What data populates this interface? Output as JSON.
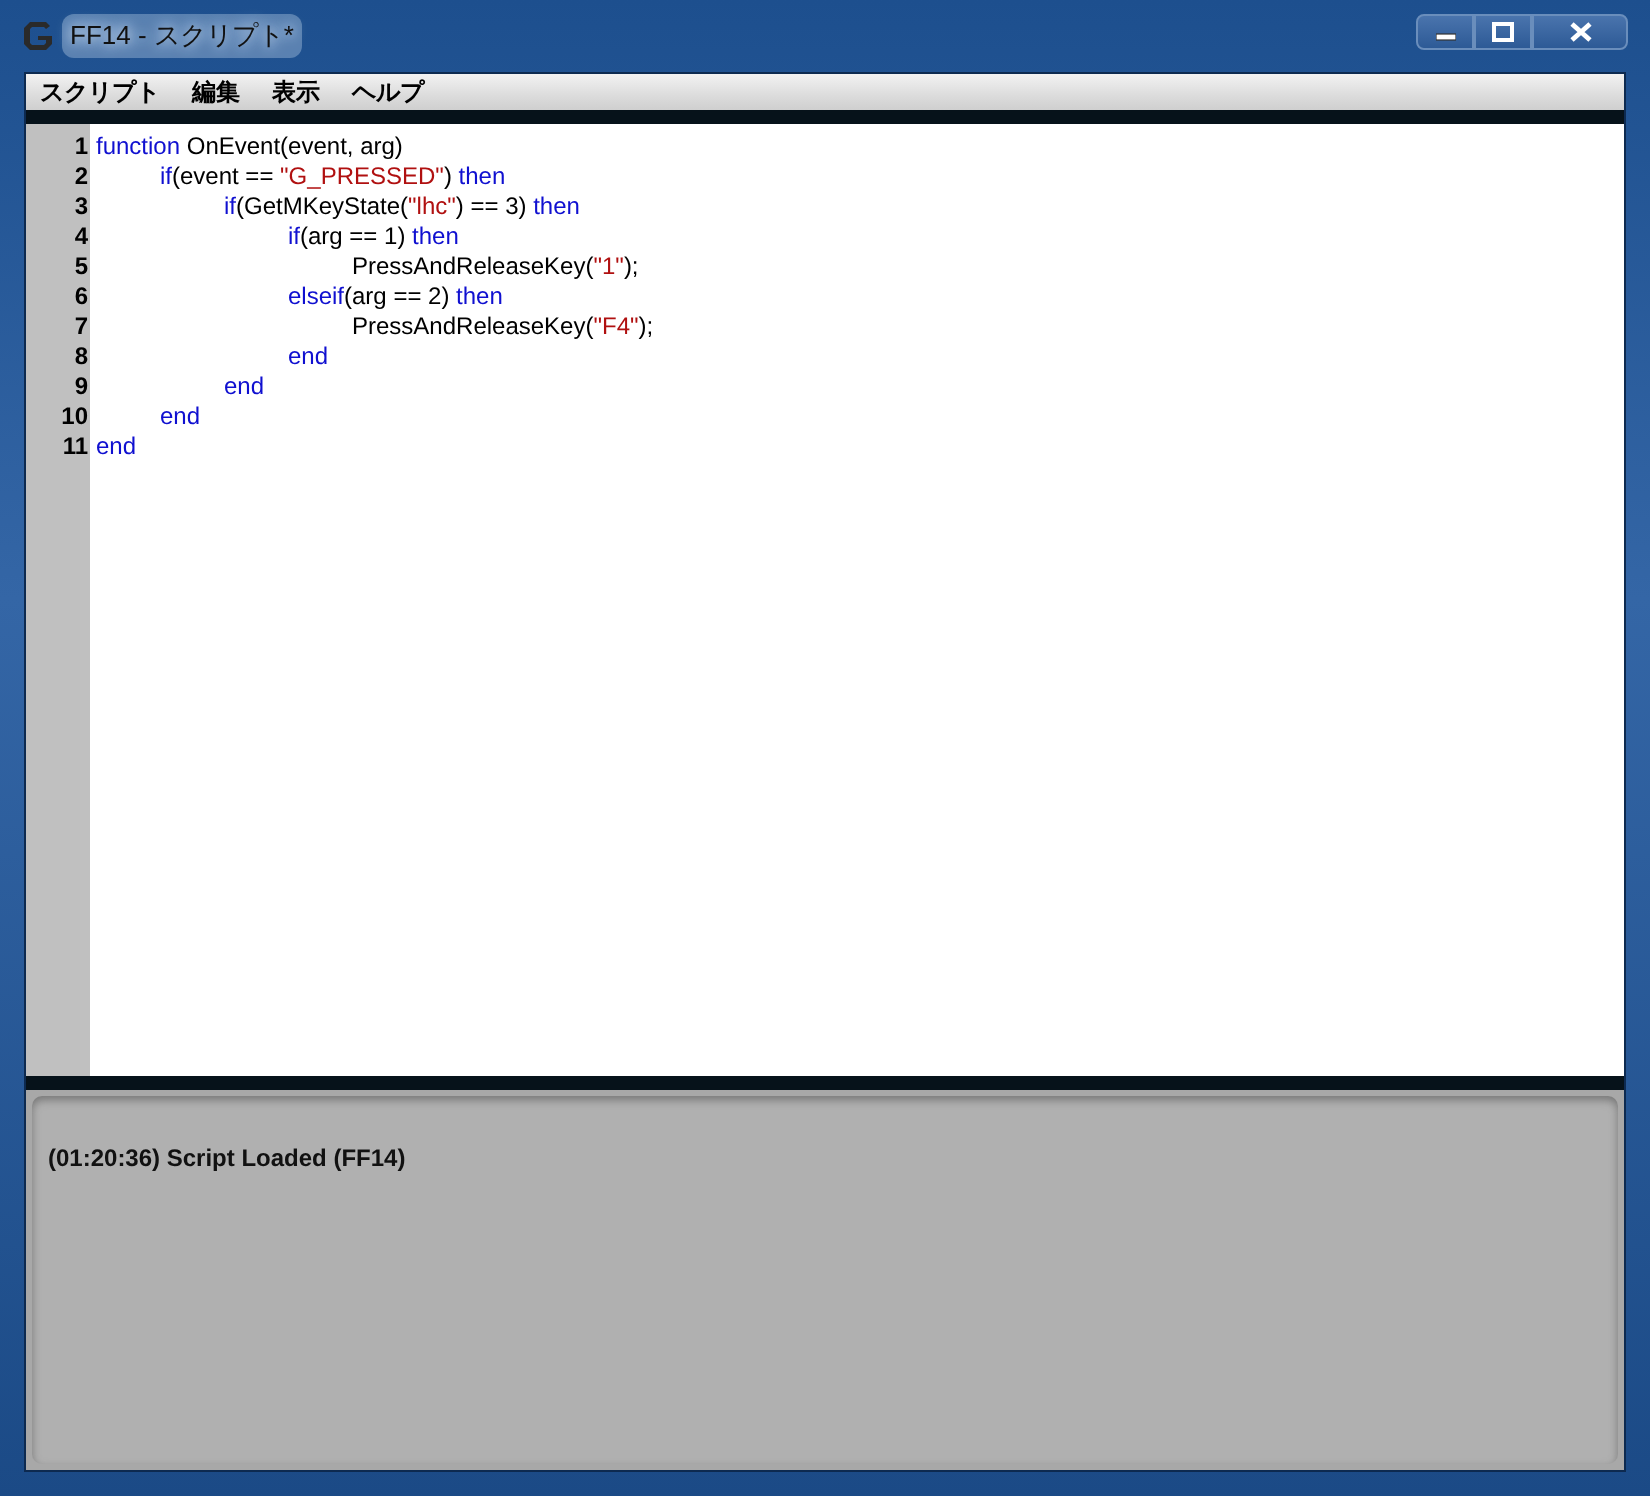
{
  "window": {
    "title": "FF14 - スクリプト*"
  },
  "menu": [
    "スクリプト",
    "編集",
    "表示",
    "ヘルプ"
  ],
  "editor": {
    "lines": [
      {
        "number": "1",
        "tokens": [
          {
            "kind": "keyword",
            "text": "function"
          },
          {
            "kind": "plain",
            "text": " OnEvent(event, arg)"
          }
        ]
      },
      {
        "number": "2",
        "tokens": [
          {
            "kind": "keyword",
            "text": "\tif"
          },
          {
            "kind": "plain",
            "text": "(event == "
          },
          {
            "kind": "string",
            "text": "\"G_PRESSED\""
          },
          {
            "kind": "plain",
            "text": ") "
          },
          {
            "kind": "keyword",
            "text": "then"
          }
        ]
      },
      {
        "number": "3",
        "tokens": [
          {
            "kind": "keyword",
            "text": "\t\tif"
          },
          {
            "kind": "plain",
            "text": "(GetMKeyState("
          },
          {
            "kind": "string",
            "text": "\"lhc\""
          },
          {
            "kind": "plain",
            "text": ") == 3) "
          },
          {
            "kind": "keyword",
            "text": "then"
          }
        ]
      },
      {
        "number": "4",
        "tokens": [
          {
            "kind": "keyword",
            "text": "\t\t\tif"
          },
          {
            "kind": "plain",
            "text": "(arg == 1) "
          },
          {
            "kind": "keyword",
            "text": "then"
          }
        ]
      },
      {
        "number": "5",
        "tokens": [
          {
            "kind": "plain",
            "text": "\t\t\t\tPressAndReleaseKey("
          },
          {
            "kind": "string",
            "text": "\"1\""
          },
          {
            "kind": "plain",
            "text": ");"
          }
        ]
      },
      {
        "number": "6",
        "tokens": [
          {
            "kind": "keyword",
            "text": "\t\t\telseif"
          },
          {
            "kind": "plain",
            "text": "(arg == 2) "
          },
          {
            "kind": "keyword",
            "text": "then"
          }
        ]
      },
      {
        "number": "7",
        "tokens": [
          {
            "kind": "plain",
            "text": "\t\t\t\tPressAndReleaseKey("
          },
          {
            "kind": "string",
            "text": "\"F4\""
          },
          {
            "kind": "plain",
            "text": ");"
          }
        ]
      },
      {
        "number": "8",
        "tokens": [
          {
            "kind": "keyword",
            "text": "\t\t\tend"
          }
        ]
      },
      {
        "number": "9",
        "tokens": [
          {
            "kind": "keyword",
            "text": "\t\tend"
          }
        ]
      },
      {
        "number": "10",
        "tokens": [
          {
            "kind": "keyword",
            "text": "\tend"
          }
        ]
      },
      {
        "number": "11",
        "tokens": [
          {
            "kind": "keyword",
            "text": "end"
          }
        ]
      }
    ]
  },
  "output": {
    "messages": [
      "(01:20:36) Script Loaded (FF14)"
    ]
  }
}
